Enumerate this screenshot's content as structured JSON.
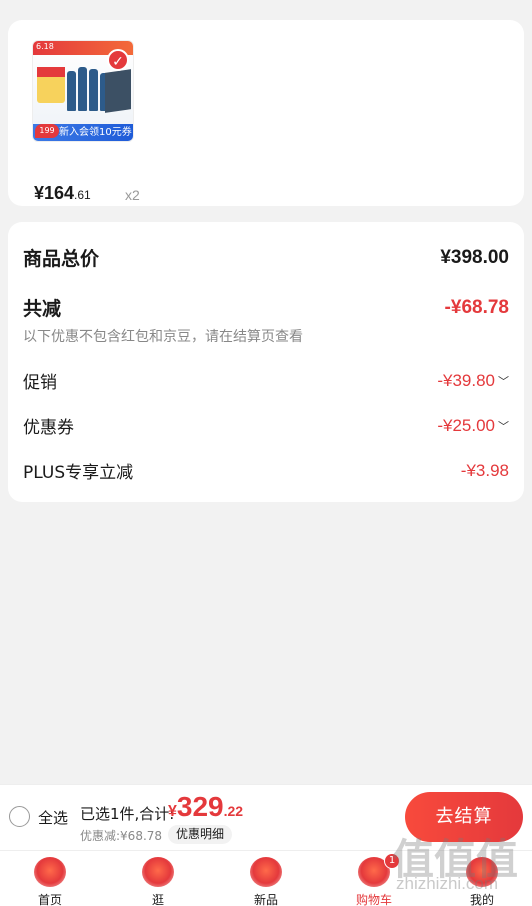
{
  "product": {
    "store_tag": "6.18",
    "promo_text": "新入会领10元券",
    "promo_badge": "199",
    "price_int": "¥164",
    "price_dec": ".61",
    "quantity": "x2"
  },
  "summary": {
    "total_label": "商品总价",
    "total_value": "¥398.00",
    "reduction_label": "共减",
    "reduction_value": "-¥68.78",
    "note": "以下优惠不包含红包和京豆，请在结算页查看",
    "items": [
      {
        "label": "促销",
        "value": "-¥39.80",
        "expandable": true
      },
      {
        "label": "优惠券",
        "value": "-¥25.00",
        "expandable": true
      },
      {
        "label": "PLUS专享立减",
        "value": "-¥3.98",
        "expandable": false
      }
    ]
  },
  "action_bar": {
    "select_all": "全选",
    "selected_text": "已选1件,合计:",
    "total_symbol": "¥",
    "total_int": "329",
    "total_dec": ".22",
    "discount_text": "优惠减:¥68.78",
    "detail_button": "优惠明细",
    "checkout_button": "去结算"
  },
  "tabs": [
    {
      "label": "首页",
      "icon": "home-icon",
      "active": false
    },
    {
      "label": "逛",
      "icon": "explore-icon",
      "active": false
    },
    {
      "label": "新品",
      "icon": "new-products-icon",
      "active": false
    },
    {
      "label": "购物车",
      "icon": "cart-icon",
      "active": true,
      "badge": "1"
    },
    {
      "label": "我的",
      "icon": "profile-icon",
      "active": false
    }
  ],
  "watermark": {
    "chars": "值值值",
    "url": "zhizhizhi.com"
  },
  "colors": {
    "accent": "#e4393c",
    "background": "#f2f2f2",
    "card": "#ffffff"
  }
}
